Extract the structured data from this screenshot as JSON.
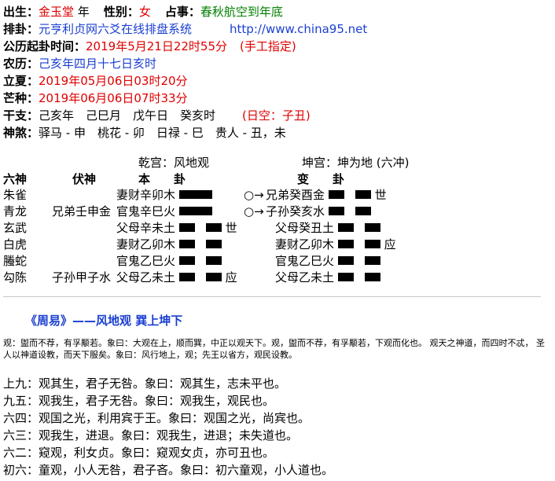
{
  "header": {
    "chusheng_label": "出生：",
    "chusheng_value": "金玉堂",
    "year_word": " 年",
    "gender_label": "性别：",
    "gender_value": "女",
    "zhanshi_label": "占事：",
    "zhanshi_value": "春秋航空到年底",
    "paigua_label": "排卦：",
    "paigua_value": "元亨利贞网六爻在线排盘系统",
    "url": "http://www.china95.net",
    "gongli_label": "公历起卦时间：",
    "gongli_value": "2019年5月21日22时55分",
    "gongli_note": "(手工指定)",
    "nongli_label": "农历：",
    "nongli_value": "己亥年四月十七日亥时",
    "lixia_label": "立夏：",
    "lixia_value": "2019年05月06日03时20分",
    "mangzhong_label": "芒种：",
    "mangzhong_value": "2019年06月06日07时33分",
    "ganzhi_label": "干支：",
    "ganzhi_value": "己亥年　己巳月　戊午日　癸亥时",
    "kongwang": "(日空：子丑)",
    "shensha_label": "神煞：",
    "shensha_value": "驿马 - 申　桃花 - 卯　日禄 - 巳　贵人 - 丑，未"
  },
  "gua": {
    "ben_gong": "乾宫：风地观",
    "bian_gong": "坤宫：坤为地 (六冲)",
    "col_liushen": "六神",
    "col_fushen": "伏神",
    "col_ben": "本　　卦",
    "col_bian": "变　　卦",
    "rows": [
      {
        "liushen": "朱雀",
        "fushen": "",
        "ben": "妻财辛卯木",
        "ben_line": "yang",
        "ben_mark": "",
        "dong": "○→",
        "bian": "兄弟癸酉金",
        "bian_line": "yin",
        "bian_mark": "世"
      },
      {
        "liushen": "青龙",
        "fushen": "兄弟壬申金",
        "ben": "官鬼辛巳火",
        "ben_line": "yang",
        "ben_mark": "",
        "dong": "○→",
        "bian": "子孙癸亥水",
        "bian_line": "yin",
        "bian_mark": ""
      },
      {
        "liushen": "玄武",
        "fushen": "",
        "ben": "父母辛未土",
        "ben_line": "yin",
        "ben_mark": "世",
        "dong": "",
        "bian": "父母癸丑土",
        "bian_line": "yin",
        "bian_mark": ""
      },
      {
        "liushen": "白虎",
        "fushen": "",
        "ben": "妻财乙卯木",
        "ben_line": "yin",
        "ben_mark": "",
        "dong": "",
        "bian": "妻财乙卯木",
        "bian_line": "yin",
        "bian_mark": "应"
      },
      {
        "liushen": "螣蛇",
        "fushen": "",
        "ben": "官鬼乙巳火",
        "ben_line": "yin",
        "ben_mark": "",
        "dong": "",
        "bian": "官鬼乙巳火",
        "bian_line": "yin",
        "bian_mark": ""
      },
      {
        "liushen": "勾陈",
        "fushen": "子孙甲子水",
        "ben": "父母乙未土",
        "ben_line": "yin",
        "ben_mark": "应",
        "dong": "",
        "bian": "父母乙未土",
        "bian_line": "yin",
        "bian_mark": ""
      }
    ]
  },
  "zhouyi": {
    "title": "《周易》——风地观 巽上坤下",
    "text": "观：盥而不荐，有孚颙若。象曰：大观在上，顺而巽，中正以观天下。观，盥而不荐，有孚颙若，下观而化也。 观天之神道，而四时不忒， 圣人以神道设教，而天下服矣。象曰：风行地上，观；先王以省方，观民设教。",
    "yao": [
      "上九：观其生，君子无咎。象曰：观其生，志未平也。",
      "九五：观我生，君子无咎。象曰：观我生，观民也。",
      "六四：观国之光，利用宾于王。象曰：观国之光，尚宾也。",
      "六三：观我生，进退。象曰：观我生，进退；未失道也。",
      "六二：窥观，利女贞。象曰：窥观女贞，亦可丑也。",
      "初六：童观，小人无咎，君子吝。象曰：初六童观，小人道也。"
    ]
  }
}
